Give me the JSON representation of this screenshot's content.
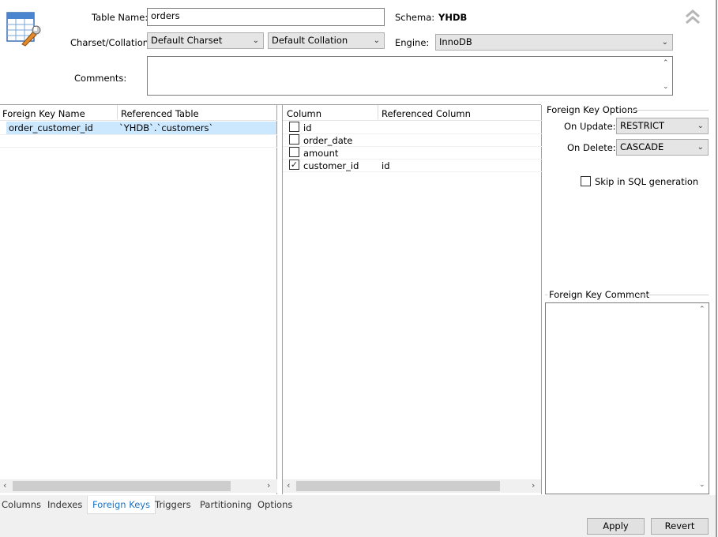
{
  "header": {
    "table_name_label": "Table Name:",
    "table_name_value": "orders",
    "schema_label": "Schema:",
    "schema_value": "YHDB",
    "charset_label": "Charset/Collation:",
    "charset_value": "Default Charset",
    "collation_value": "Default Collation",
    "engine_label": "Engine:",
    "engine_value": "InnoDB",
    "comments_label": "Comments:",
    "collapse_icon": "double-chevron-up-icon"
  },
  "fk_list": {
    "col_name": "Foreign Key Name",
    "col_ref_table": "Referenced Table",
    "rows": [
      {
        "name": "order_customer_id",
        "ref_table": "`YHDB`.`customers`"
      }
    ]
  },
  "column_list": {
    "col_column": "Column",
    "col_ref_column": "Referenced Column",
    "rows": [
      {
        "column": "id",
        "checked": false,
        "ref": ""
      },
      {
        "column": "order_date",
        "checked": false,
        "ref": ""
      },
      {
        "column": "amount",
        "checked": false,
        "ref": ""
      },
      {
        "column": "customer_id",
        "checked": true,
        "ref": "id"
      }
    ]
  },
  "options": {
    "group_title": "Foreign Key Options",
    "on_update_label": "On Update:",
    "on_update_value": "RESTRICT",
    "on_delete_label": "On Delete:",
    "on_delete_value": "CASCADE",
    "skip_sql_label": "Skip in SQL generation",
    "skip_sql_checked": false,
    "comment_title": "Foreign Key Comment"
  },
  "tabs": [
    {
      "label": "Columns"
    },
    {
      "label": "Indexes"
    },
    {
      "label": "Foreign Keys",
      "active": true
    },
    {
      "label": "Triggers"
    },
    {
      "label": "Partitioning"
    },
    {
      "label": "Options"
    }
  ],
  "buttons": {
    "apply": "Apply",
    "revert": "Revert"
  }
}
